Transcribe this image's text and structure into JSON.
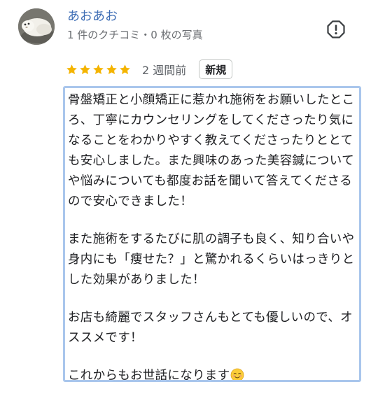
{
  "reviewer": {
    "name": "あおあお",
    "meta": "1 件のクチコミ・0 枚の写真"
  },
  "review": {
    "rating": 5,
    "rating_max": 5,
    "date": "2 週間前",
    "badge": "新規",
    "paragraphs": [
      "骨盤矯正と小顔矯正に惹かれ施術をお願いしたところ、丁寧にカウンセリングをしてくださったり気になることをわかりやすく教えてくださったりととても安心しました。また興味のあった美容鍼についてや悩みについても都度お話を聞いて答えてくださるので安心できました！",
      "また施術をするたびに肌の調子も良く、知り合いや身内にも「痩せた？」と驚かれるくらいはっきりとした効果がありました！",
      "お店も綺麗でスタッフさんもとても優しいので、オススメです！",
      "これからもお世話になります"
    ],
    "closing_emoji": "smiling-face-emoji"
  },
  "icons": {
    "report": "report-icon",
    "star": "star-icon"
  },
  "colors": {
    "name": "#3c6cb4",
    "star": "#f4b400",
    "highlight_border": "#a9c6ec",
    "meta_text": "#6b6e72"
  }
}
